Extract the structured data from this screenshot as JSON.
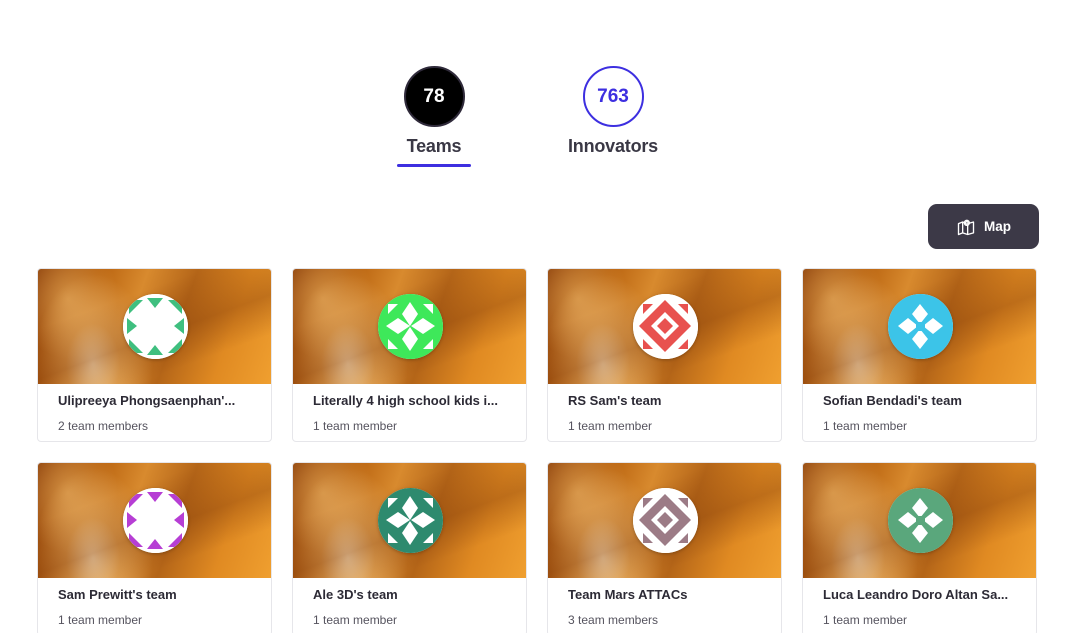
{
  "stats": {
    "teams": {
      "count": "78",
      "label": "Teams"
    },
    "innovators": {
      "count": "763",
      "label": "Innovators"
    }
  },
  "map_button": {
    "label": "Map",
    "icon": "map-icon"
  },
  "colors": {
    "accent": "#3d2fe0",
    "dark_button": "#3c3947"
  },
  "teams": [
    {
      "name": "Ulipreeya Phongsaenphan'...",
      "members": "2 team members",
      "avatar_color": "#3fbf7f"
    },
    {
      "name": "Literally 4 high school kids i...",
      "members": "1 team member",
      "avatar_color": "#3ee85a"
    },
    {
      "name": "RS Sam's team",
      "members": "1 team member",
      "avatar_color": "#e8514f"
    },
    {
      "name": "Sofian Bendadi's team",
      "members": "1 team member",
      "avatar_color": "#3cc4e8"
    },
    {
      "name": "Sam Prewitt's team",
      "members": "1 team member",
      "avatar_color": "#b63ed4"
    },
    {
      "name": "Ale 3D's team",
      "members": "1 team member",
      "avatar_color": "#2e8a6e"
    },
    {
      "name": "Team Mars ATTACs",
      "members": "3 team members",
      "avatar_color": "#9c7b86"
    },
    {
      "name": "Luca Leandro Doro Altan Sa...",
      "members": "1 team member",
      "avatar_color": "#5aa77c"
    }
  ]
}
